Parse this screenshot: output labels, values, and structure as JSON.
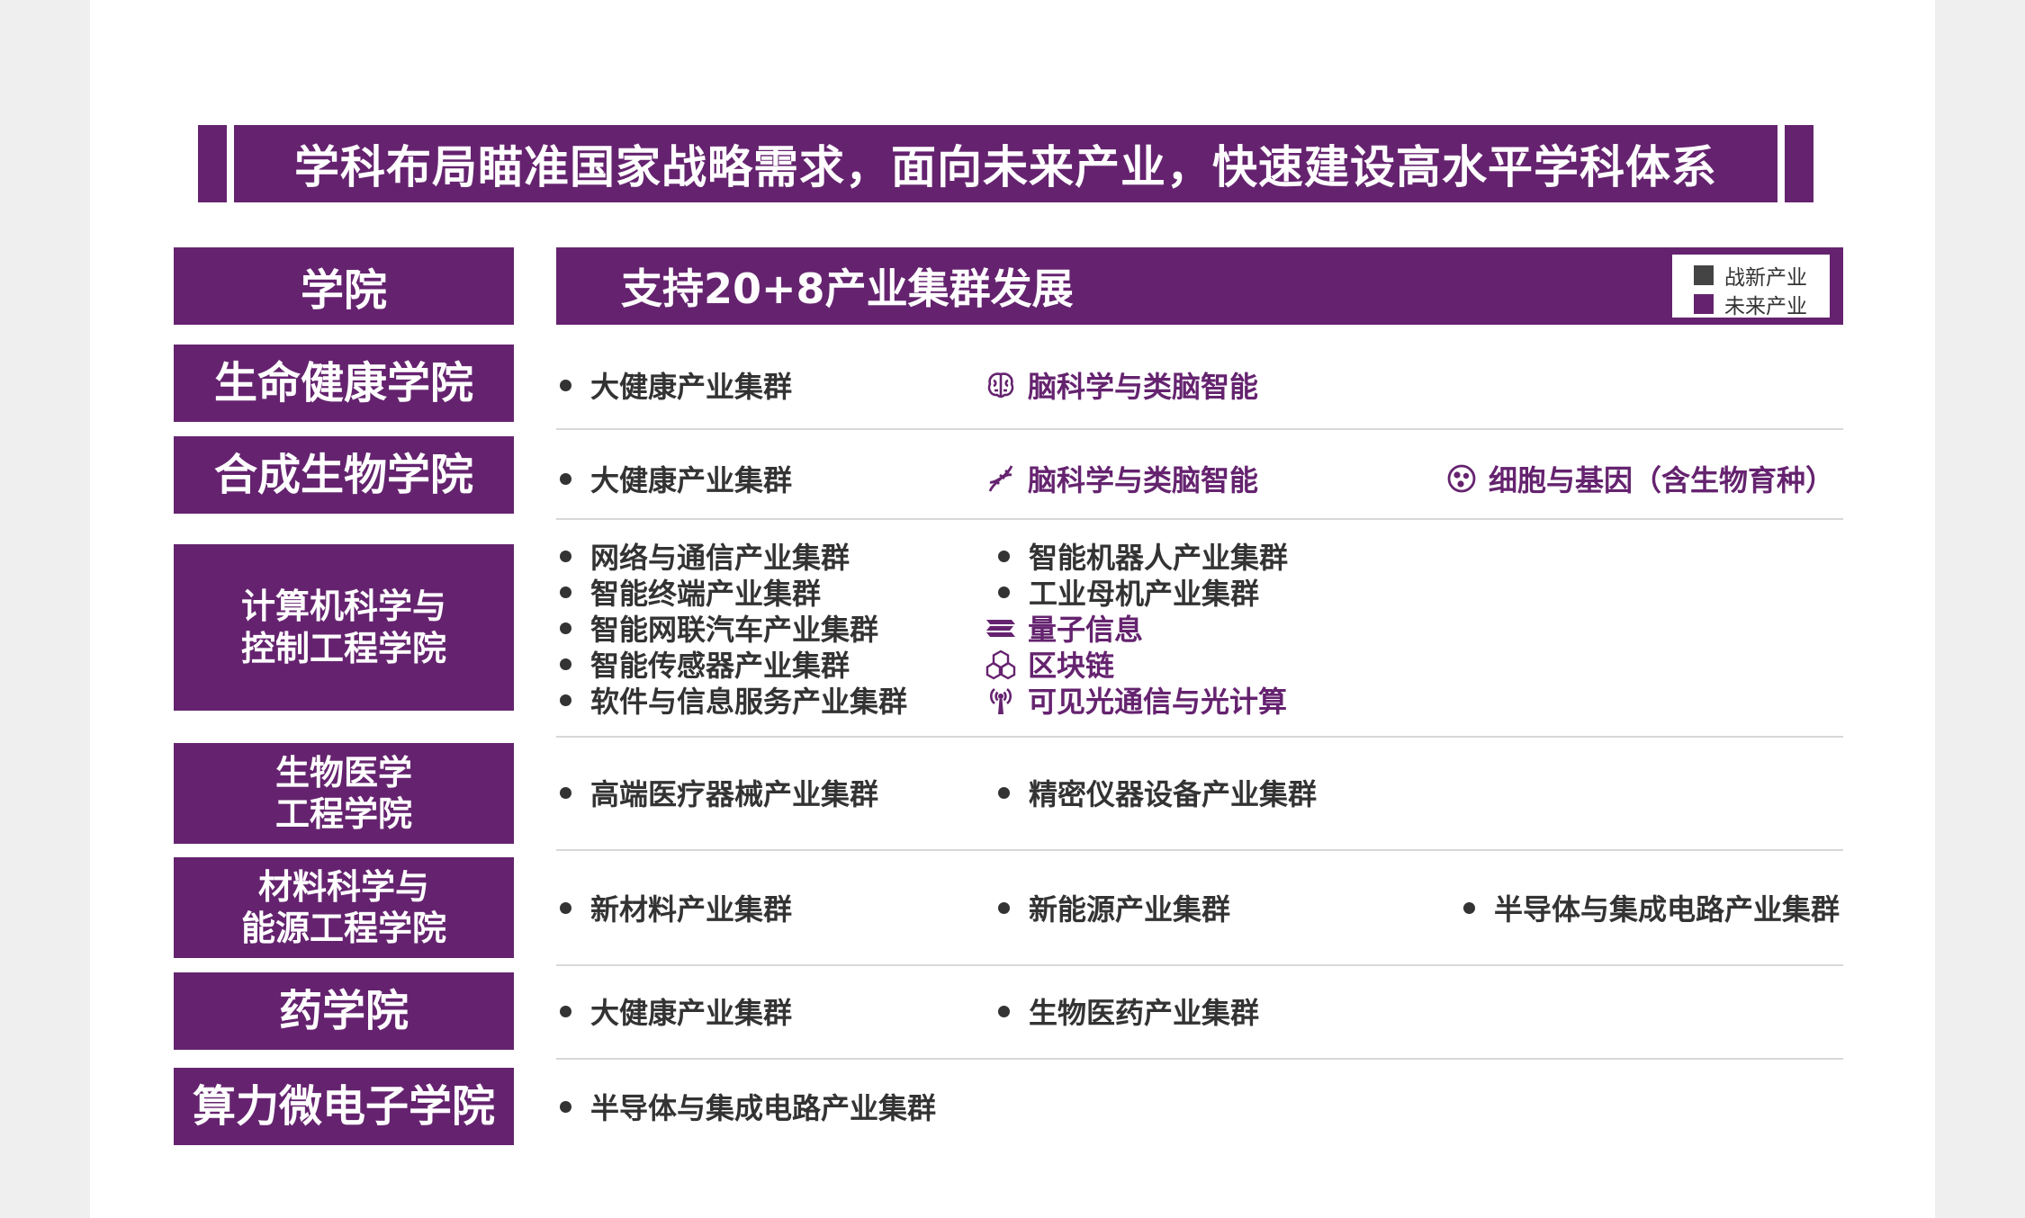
{
  "banner": {
    "title": "学科布局瞄准国家战略需求，面向未来产业，快速建设高水平学科体系"
  },
  "header": {
    "college_label": "学院",
    "support_label": "支持20+8产业集群发展",
    "legend": [
      {
        "label": "战新产业",
        "color": "#444444"
      },
      {
        "label": "未来产业",
        "color": "#65236f"
      }
    ]
  },
  "colors": {
    "brand": "#65236f",
    "text": "#333333"
  },
  "rows": [
    {
      "college": "生命健康学院",
      "items": [
        {
          "text": "大健康产业集群",
          "kind": "strategic",
          "icon": "bullet"
        },
        {
          "text": "脑科学与类脑智能",
          "kind": "future",
          "icon": "brain-icon"
        }
      ]
    },
    {
      "college": "合成生物学院",
      "items": [
        {
          "text": "大健康产业集群",
          "kind": "strategic",
          "icon": "bullet"
        },
        {
          "text": "脑科学与类脑智能",
          "kind": "future",
          "icon": "dna-icon"
        },
        {
          "text": "细胞与基因（含生物育种）",
          "kind": "future",
          "icon": "cell-icon"
        }
      ]
    },
    {
      "college": "计算机科学与\n控制工程学院",
      "items": [
        {
          "text": "网络与通信产业集群",
          "kind": "strategic",
          "icon": "bullet"
        },
        {
          "text": "智能终端产业集群",
          "kind": "strategic",
          "icon": "bullet"
        },
        {
          "text": "智能网联汽车产业集群",
          "kind": "strategic",
          "icon": "bullet"
        },
        {
          "text": "智能传感器产业集群",
          "kind": "strategic",
          "icon": "bullet"
        },
        {
          "text": "软件与信息服务产业集群",
          "kind": "strategic",
          "icon": "bullet"
        },
        {
          "text": "智能机器人产业集群",
          "kind": "strategic",
          "icon": "bullet"
        },
        {
          "text": "工业母机产业集群",
          "kind": "strategic",
          "icon": "bullet"
        },
        {
          "text": "量子信息",
          "kind": "future",
          "icon": "quantum-icon"
        },
        {
          "text": "区块链",
          "kind": "future",
          "icon": "blockchain-icon"
        },
        {
          "text": "可见光通信与光计算",
          "kind": "future",
          "icon": "signal-icon"
        }
      ]
    },
    {
      "college": "生物医学\n工程学院",
      "items": [
        {
          "text": "高端医疗器械产业集群",
          "kind": "strategic",
          "icon": "bullet"
        },
        {
          "text": "精密仪器设备产业集群",
          "kind": "strategic",
          "icon": "bullet"
        }
      ]
    },
    {
      "college": "材料科学与\n能源工程学院",
      "items": [
        {
          "text": "新材料产业集群",
          "kind": "strategic",
          "icon": "bullet"
        },
        {
          "text": "新能源产业集群",
          "kind": "strategic",
          "icon": "bullet"
        },
        {
          "text": "半导体与集成电路产业集群",
          "kind": "strategic",
          "icon": "bullet"
        }
      ]
    },
    {
      "college": "药学院",
      "items": [
        {
          "text": "大健康产业集群",
          "kind": "strategic",
          "icon": "bullet"
        },
        {
          "text": "生物医药产业集群",
          "kind": "strategic",
          "icon": "bullet"
        }
      ]
    },
    {
      "college": "算力微电子学院",
      "items": [
        {
          "text": "半导体与集成电路产业集群",
          "kind": "strategic",
          "icon": "bullet"
        }
      ]
    }
  ]
}
